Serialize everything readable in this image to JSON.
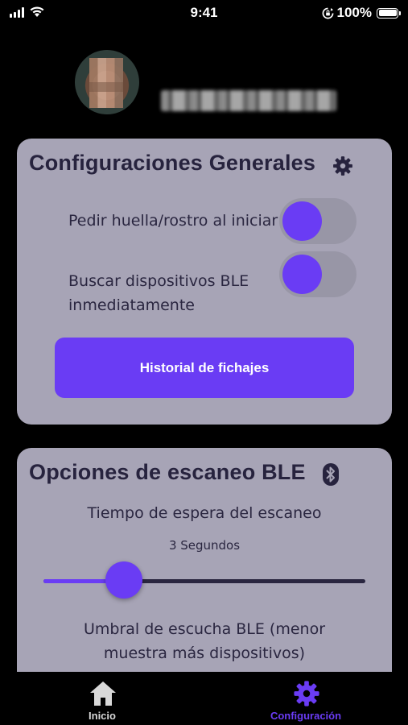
{
  "status_bar": {
    "time": "9:41",
    "battery": "100%"
  },
  "general_settings": {
    "title": "Configuraciones Generales",
    "icon": "gear-icon",
    "rows": [
      {
        "label": "Pedir huella/rostro al iniciar",
        "enabled": true
      },
      {
        "label_line1": "Buscar dispositivos BLE",
        "label_line2": "inmediatamente",
        "enabled": true
      }
    ],
    "history_button": "Historial de fichajes"
  },
  "ble_options": {
    "title": "Opciones de escaneo BLE",
    "icon": "bluetooth-icon",
    "scan_wait_label": "Tiempo de espera del escaneo",
    "scan_wait_value": "3 Segundos",
    "scan_wait_fraction": 0.25,
    "threshold_line1": "Umbral de escucha BLE (menor",
    "threshold_line2": "muestra más dispositivos)"
  },
  "tabs": [
    {
      "label": "Inicio",
      "icon": "home-icon",
      "active": false
    },
    {
      "label": "Configuración",
      "icon": "gear-icon",
      "active": true
    }
  ],
  "colors": {
    "accent": "#6a3cf4",
    "card": "#a7a4b6",
    "text": "#27233e",
    "inactive_tab": "#d8d8d8"
  }
}
